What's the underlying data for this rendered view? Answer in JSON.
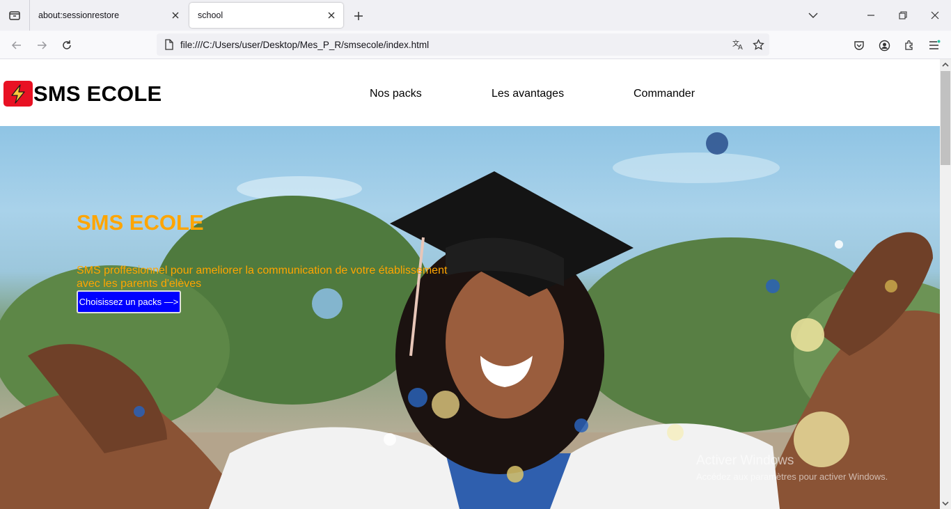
{
  "browser": {
    "tabs": [
      {
        "title": "about:sessionrestore",
        "active": false
      },
      {
        "title": "school",
        "active": true
      }
    ],
    "url": "file:///C:/Users/user/Desktop/Mes_P_R/smsecole/index.html"
  },
  "site": {
    "logo_text": "SMS ECOLE",
    "nav": [
      "Nos packs",
      "Les avantages",
      "Commander"
    ]
  },
  "hero": {
    "title": "SMS ECOLE",
    "subtitle": "SMS proffesionnel pour ameliorer la communication de votre établissement avec les parents d'elèves",
    "cta": "Choisissez un packs —>"
  },
  "watermark": {
    "line1": "Activer Windows",
    "line2": "Accédez aux paramètres pour activer Windows."
  },
  "colors": {
    "accent": "#ffa500",
    "cta": "#0000ff",
    "logo_badge": "#e81123"
  }
}
